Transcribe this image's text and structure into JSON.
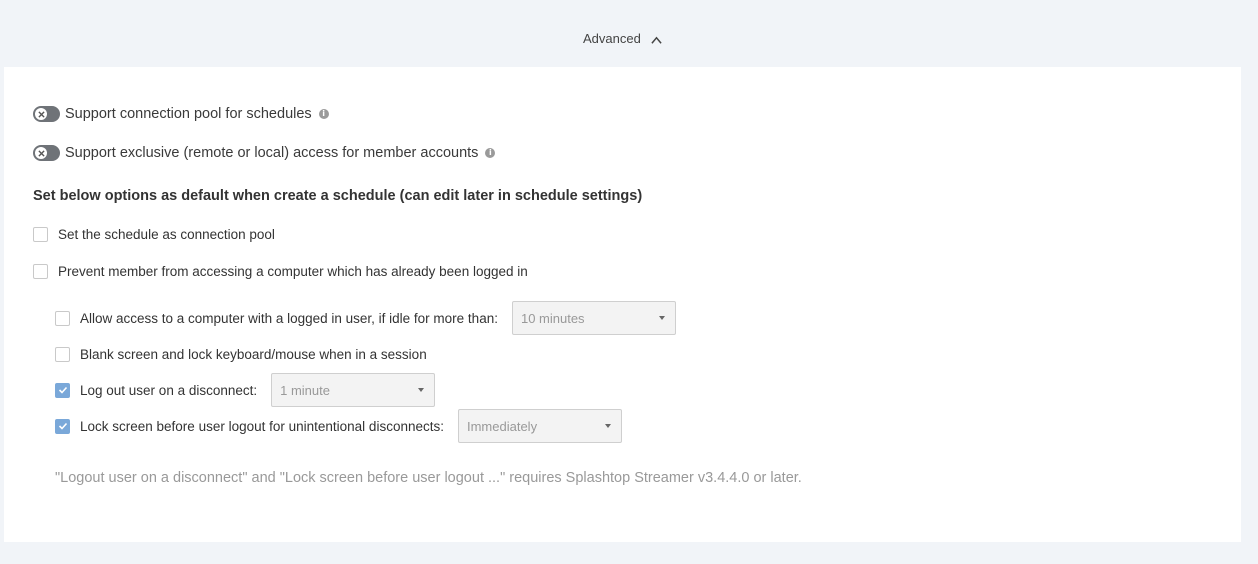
{
  "advanced": {
    "label": "Advanced"
  },
  "toggles": [
    {
      "label": "Support connection pool for schedules",
      "enabled": false
    },
    {
      "label": "Support exclusive (remote or local) access for member accounts",
      "enabled": false
    }
  ],
  "info_icon_glyph": "i",
  "defaults": {
    "heading": "Set below options as default when create a schedule (can edit later in schedule settings)",
    "connection_pool": {
      "label": "Set the schedule as connection pool",
      "checked": false
    },
    "prevent_access": {
      "label": "Prevent member from accessing a computer which has already been logged in",
      "checked": false
    },
    "allow_idle": {
      "label": "Allow access to a computer with a logged in user, if idle for more than:",
      "checked": false,
      "select_value": "10 minutes"
    },
    "blank_screen": {
      "label": "Blank screen and lock keyboard/mouse when in a session",
      "checked": false
    },
    "logout": {
      "label": "Log out user on a disconnect:",
      "checked": true,
      "select_value": "1 minute"
    },
    "lock_screen": {
      "label": "Lock screen before user logout for unintentional disconnects:",
      "checked": true,
      "select_value": "Immediately"
    }
  },
  "note": "\"Logout user on a disconnect\" and \"Lock screen before user logout ...\" requires Splashtop Streamer v3.4.4.0 or later.",
  "colors": {
    "checkbox_checked": "#7aa8d9",
    "switch_off": "#6f7378",
    "background": "#f1f4f8"
  }
}
